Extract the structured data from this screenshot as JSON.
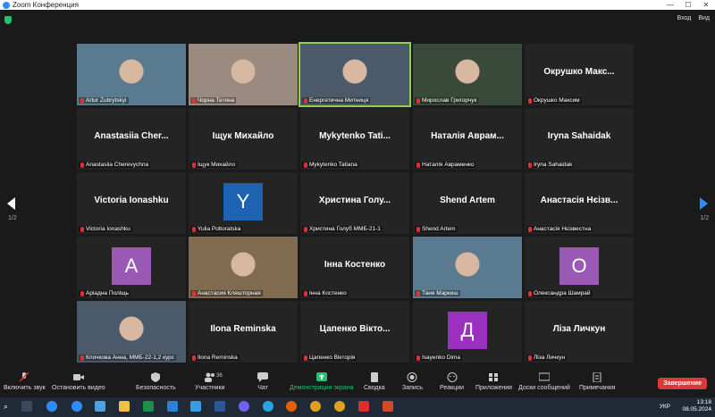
{
  "window": {
    "title": "Zoom Конференция"
  },
  "topbar": {
    "enter": "Вход",
    "view": "Вид"
  },
  "pager": {
    "left": "1/2",
    "right": "1/2"
  },
  "tiles": [
    {
      "caption": "Artur Zubrytskyi",
      "big": "",
      "avatar": "",
      "video": true
    },
    {
      "caption": "Чорна Тетяна",
      "big": "",
      "avatar": "",
      "video": true
    },
    {
      "caption": "Енергетична Митниця",
      "big": "",
      "avatar": "",
      "video": true,
      "active": true
    },
    {
      "caption": "Мирослав Григорчук",
      "big": "",
      "avatar": "",
      "video": true
    },
    {
      "caption": "Окрушко Максим",
      "big": "Окрушко Макс...",
      "avatar": "",
      "video": false
    },
    {
      "caption": "Anastasiia Cherevychna",
      "big": "Anastasiia Cher...",
      "avatar": "",
      "video": false
    },
    {
      "caption": "Іщук Михайло",
      "big": "Іщук Михайло",
      "avatar": "",
      "video": false
    },
    {
      "caption": "Mykytenko Tatiana",
      "big": "Mykytenko Tati...",
      "avatar": "",
      "video": false
    },
    {
      "caption": "Наталія Авраменко",
      "big": "Наталія Аврам...",
      "avatar": "",
      "video": false
    },
    {
      "caption": "Iryna Sahaidak",
      "big": "Iryna Sahaidak",
      "avatar": "",
      "video": false
    },
    {
      "caption": "Victoria Ionashku",
      "big": "Victoria Ionashku",
      "avatar": "",
      "video": false
    },
    {
      "caption": "Yulia Poltoratska",
      "big": "",
      "avatar": "Y",
      "avatarColor": "#1e62b4",
      "video": false
    },
    {
      "caption": "Христина Голуб ММБ-21-1",
      "big": "Христина Голу...",
      "avatar": "",
      "video": false
    },
    {
      "caption": "Shend Artem",
      "big": "Shend Artem",
      "avatar": "",
      "video": false
    },
    {
      "caption": "Анастасія Нєізвестна",
      "big": "Анастасія Нєізв...",
      "avatar": "",
      "video": false
    },
    {
      "caption": "Аріадна Поліщь",
      "big": "",
      "avatar": "A",
      "avatarColor": "#9b59b6",
      "video": false
    },
    {
      "caption": "Анастасия Кляшторная",
      "big": "",
      "avatar": "",
      "video": true
    },
    {
      "caption": "Інна Костенко",
      "big": "Інна Костенко",
      "avatar": "",
      "video": false
    },
    {
      "caption": "Таня Маркиш",
      "big": "",
      "avatar": "",
      "video": true
    },
    {
      "caption": "Олександра Шамрай",
      "big": "",
      "avatar": "O",
      "avatarColor": "#9b59b6",
      "video": false
    },
    {
      "caption": "Клочкова Анна, ММБ-22-1,2 курс",
      "big": "",
      "avatar": "",
      "video": true
    },
    {
      "caption": "Ilona Reminska",
      "big": "Ilona Reminska",
      "avatar": "",
      "video": false
    },
    {
      "caption": "Цапенко Вікторія",
      "big": "Цапенко Вікто...",
      "avatar": "",
      "video": false
    },
    {
      "caption": "Isayenko Dima",
      "big": "",
      "avatar": "Д",
      "avatarColor": "#9b30c0",
      "video": false
    },
    {
      "caption": "Ліза Личкун",
      "big": "Ліза Личкун",
      "avatar": "",
      "video": false
    }
  ],
  "toolbar": {
    "unmute": "Включить звук",
    "stop_video": "Остановить видео",
    "security": "Безопасность",
    "participants": "Участники",
    "participants_count": "36",
    "chat": "Чат",
    "share": "Демонстрация экрана",
    "summary": "Сводка",
    "record": "Запись",
    "reactions": "Реакции",
    "apps": "Приложения",
    "whiteboards": "Доски сообщений",
    "notes": "Примечания",
    "end": "Завершение"
  },
  "taskbar": {
    "lang": "УКР",
    "time": "13:18",
    "date": "08.05.2024"
  },
  "colors": {
    "active_border": "#8fd14f",
    "share_green": "#23c16b",
    "end_red": "#d83a3a"
  }
}
